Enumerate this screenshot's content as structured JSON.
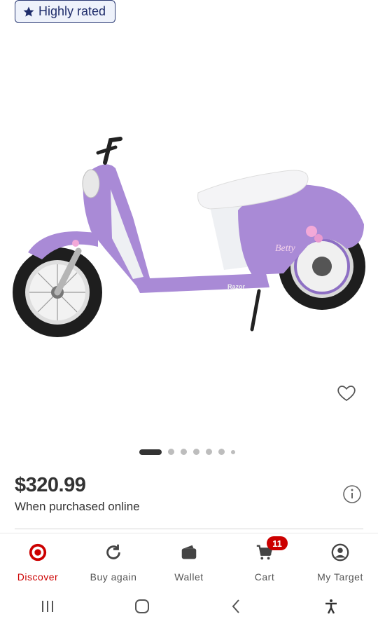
{
  "badge": {
    "label": "Highly rated",
    "icon": "star-icon"
  },
  "product": {
    "image_icon": "scooter-image",
    "image_brand_text": "Razor",
    "image_decal_text": "Betty"
  },
  "carousel": {
    "total_dots": 7,
    "active_index": 0
  },
  "pricing": {
    "price": "$320.99",
    "note": "When purchased online"
  },
  "nav": {
    "items": [
      {
        "label": "Discover",
        "icon": "target-logo-icon",
        "active": true
      },
      {
        "label": "Buy again",
        "icon": "refresh-icon",
        "active": false
      },
      {
        "label": "Wallet",
        "icon": "wallet-icon",
        "active": false
      },
      {
        "label": "Cart",
        "icon": "cart-icon",
        "active": false,
        "badge": "11"
      },
      {
        "label": "My Target",
        "icon": "account-icon",
        "active": false
      }
    ]
  },
  "colors": {
    "brand": "#cc0000",
    "badge_border": "#2b3a73",
    "scooter": "#a98ad6"
  }
}
